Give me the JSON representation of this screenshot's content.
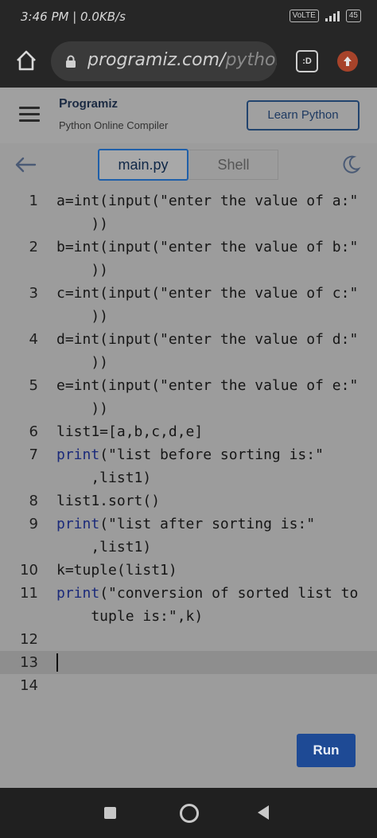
{
  "status_bar": {
    "time": "3:46 PM | 0.0KB/s",
    "network_badge": "VoLTE",
    "battery": "45"
  },
  "browser": {
    "url_domain": "programiz.com/",
    "url_path": "python",
    "tabs_label": ":D"
  },
  "site": {
    "logo_mark": "P",
    "logo_text": "rogramiz",
    "subtitle": "Python Online Compiler",
    "learn_button": "Learn Python"
  },
  "toolbar": {
    "tabs": [
      {
        "label": "main.py",
        "active": true
      },
      {
        "label": "Shell",
        "active": false
      }
    ]
  },
  "editor": {
    "lines": [
      {
        "num": "1",
        "text": "a=int(input(\"enter the value of a:\""
      },
      {
        "num": "",
        "text": "    ))"
      },
      {
        "num": "2",
        "text": "b=int(input(\"enter the value of b:\""
      },
      {
        "num": "",
        "text": "    ))"
      },
      {
        "num": "3",
        "text": "c=int(input(\"enter the value of c:\""
      },
      {
        "num": "",
        "text": "    ))"
      },
      {
        "num": "4",
        "text": "d=int(input(\"enter the value of d:\""
      },
      {
        "num": "",
        "text": "    ))"
      },
      {
        "num": "5",
        "text": "e=int(input(\"enter the value of e:\""
      },
      {
        "num": "",
        "text": "    ))"
      },
      {
        "num": "6",
        "text": "list1=[a,b,c,d,e]"
      },
      {
        "num": "7",
        "text": "print(\"list before sorting is:\""
      },
      {
        "num": "",
        "text": "    ,list1)"
      },
      {
        "num": "8",
        "text": "list1.sort()"
      },
      {
        "num": "9",
        "text": "print(\"list after sorting is:\""
      },
      {
        "num": "",
        "text": "    ,list1)"
      },
      {
        "num": "10",
        "text": "k=tuple(list1)"
      },
      {
        "num": "11",
        "text": "print(\"conversion of sorted list to"
      },
      {
        "num": "",
        "text": "    tuple is:\",k)"
      },
      {
        "num": "12",
        "text": ""
      },
      {
        "num": "13",
        "text": ""
      },
      {
        "num": "14",
        "text": ""
      }
    ],
    "run_button": "Run"
  }
}
